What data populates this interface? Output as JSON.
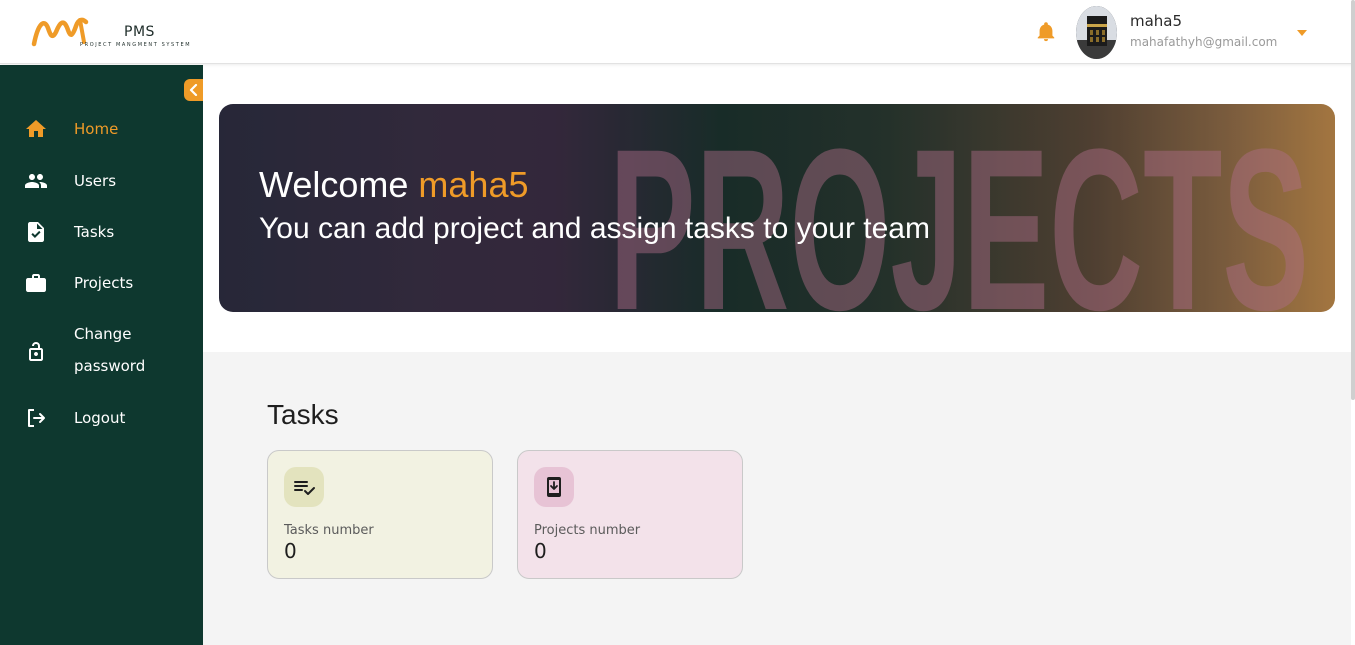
{
  "brand": {
    "name": "PMS",
    "tagline": "PROJECT MANGMENT SYSTEM",
    "accent_color": "#ef9b28",
    "sidebar_color": "#0e382f"
  },
  "header": {
    "notification_icon": "bell-icon",
    "user_name": "maha5",
    "user_email": "mahafathyh@gmail.com",
    "menu_icon": "caret-down-icon"
  },
  "sidebar": {
    "collapse_icon": "chevron-left-icon",
    "items": [
      {
        "label": "Home",
        "icon": "home-icon",
        "active": true
      },
      {
        "label": "Users",
        "icon": "users-icon",
        "active": false
      },
      {
        "label": "Tasks",
        "icon": "task-file-icon",
        "active": false
      },
      {
        "label": "Projects",
        "icon": "briefcase-icon",
        "active": false
      },
      {
        "label_line1": "Change",
        "label_line2": "password",
        "icon": "lock-icon",
        "active": false
      },
      {
        "label": "Logout",
        "icon": "logout-icon",
        "active": false
      }
    ]
  },
  "banner": {
    "welcome_prefix": "Welcome",
    "user_name": "maha5",
    "subtitle": "You can add project and assign tasks to your team",
    "background_text": "PROJECTS"
  },
  "tasks_section": {
    "title": "Tasks",
    "cards": [
      {
        "label": "Tasks number",
        "value": "0",
        "icon": "checklist-icon",
        "color": "#f2f2e2"
      },
      {
        "label": "Projects number",
        "value": "0",
        "icon": "phone-download-icon",
        "color": "#f3e2ea"
      }
    ]
  }
}
